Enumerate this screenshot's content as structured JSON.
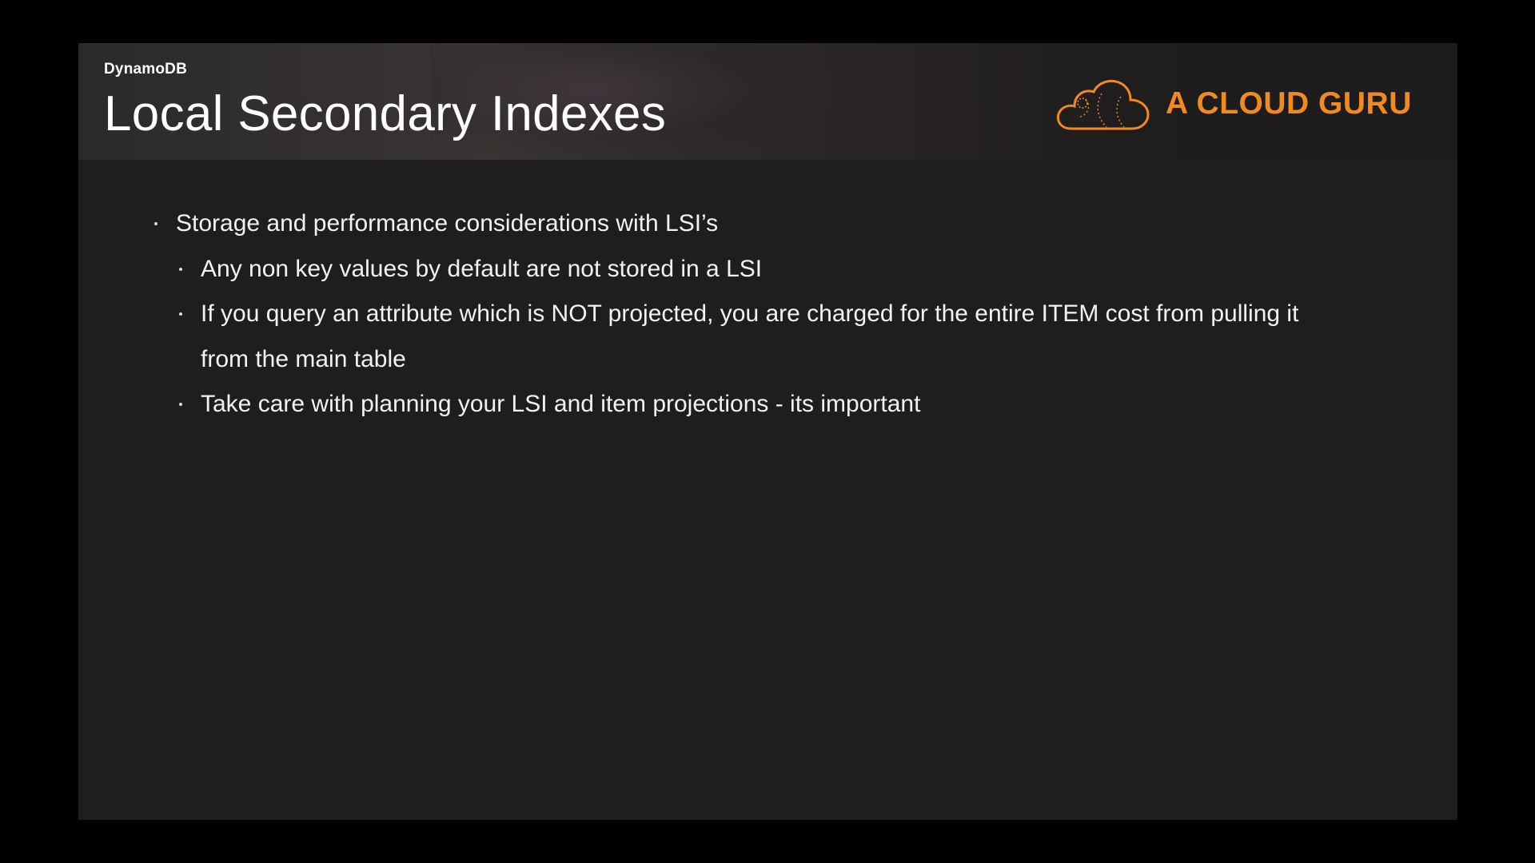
{
  "slide": {
    "kicker": "DynamoDB",
    "title": "Local Secondary Indexes"
  },
  "logo": {
    "icon": "cloud-icon",
    "text": "A CLOUD GURU",
    "color": "#f18a21"
  },
  "bullets": [
    {
      "level": 1,
      "text": "Storage and performance considerations with LSI’s"
    },
    {
      "level": 2,
      "text": "Any non key values by default are not stored in a LSI"
    },
    {
      "level": 2,
      "text": "If you query an attribute which is NOT projected, you are charged for the entire ITEM cost from pulling it"
    },
    {
      "level": 2,
      "text": "from the main table",
      "continuation": true
    },
    {
      "level": 2,
      "text": "Take care with planning your LSI and item projections - its important"
    }
  ]
}
